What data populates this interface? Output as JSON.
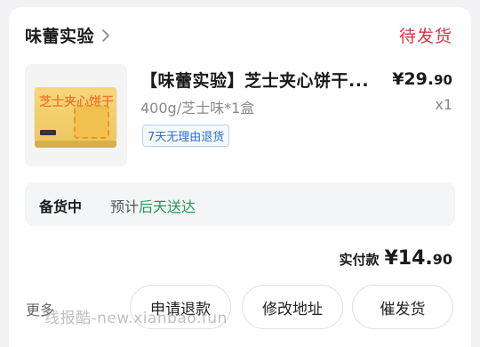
{
  "shop": {
    "name": "味蕾实验",
    "chevron_icon": "chevron-right-icon"
  },
  "order_status": "待发货",
  "product": {
    "image_alt": "cheese-sandwich-biscuit-box",
    "box_text": "芝士夹心饼干",
    "title": "【味蕾实验】芝士夹心饼干...",
    "price_main": "¥29.",
    "price_cents": "90",
    "spec": "400g/芝士味*1盒",
    "quantity": "x1",
    "service_tag": "7天无理由退货"
  },
  "stock": {
    "label": "备货中",
    "prefix": "预计",
    "eta": "后天送达"
  },
  "payment": {
    "label": "实付款",
    "amount_main": "¥14.",
    "amount_cents": "90"
  },
  "actions": {
    "more": "更多",
    "refund": "申请退款",
    "change_address": "修改地址",
    "urge_shipping": "催发货"
  },
  "watermark": "线报酷-new.xianbao.fun",
  "colors": {
    "status": "#d8344a",
    "eta": "#1f9a52",
    "tag": "#2f6fd0"
  }
}
